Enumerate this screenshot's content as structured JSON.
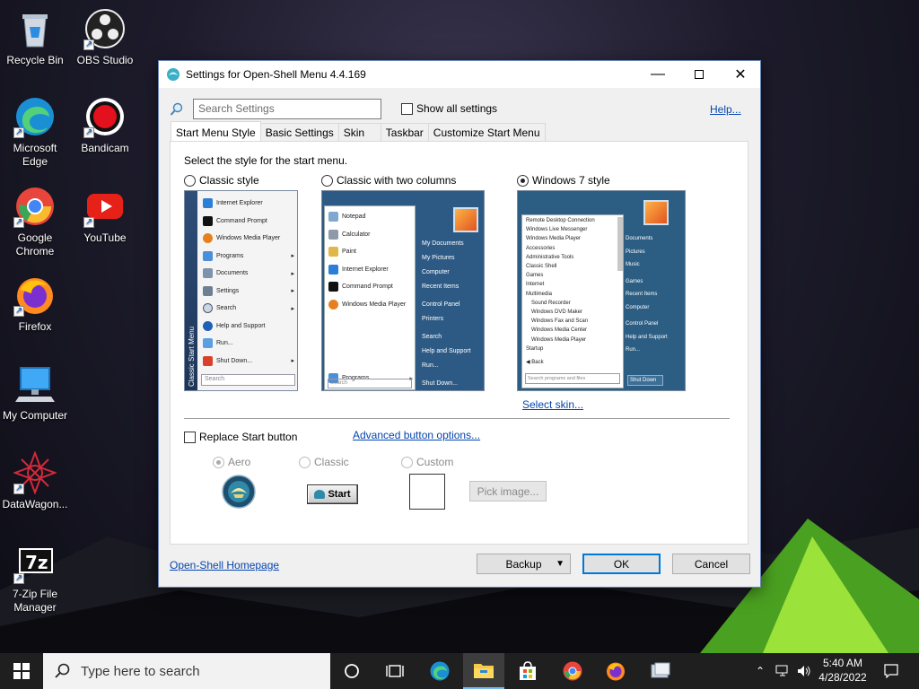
{
  "desktop": {
    "icons": [
      {
        "label": "Recycle Bin"
      },
      {
        "label": "OBS Studio"
      },
      {
        "label": "Microsoft Edge"
      },
      {
        "label": "Bandicam"
      },
      {
        "label": "Google Chrome"
      },
      {
        "label": "YouTube"
      },
      {
        "label": "Firefox"
      },
      {
        "label": "My Computer"
      },
      {
        "label": "DataWagon..."
      },
      {
        "label": "7-Zip File Manager"
      }
    ]
  },
  "window": {
    "title": "Settings for Open-Shell Menu 4.4.169",
    "search_placeholder": "Search Settings",
    "show_all_label": "Show all settings",
    "help_link": "Help...",
    "tabs": [
      {
        "label": "Start Menu Style"
      },
      {
        "label": "Basic Settings"
      },
      {
        "label": "Skin"
      },
      {
        "label": "Taskbar"
      },
      {
        "label": "Customize Start Menu"
      }
    ],
    "prompt": "Select the style for the start menu.",
    "styles": [
      {
        "label": "Classic style",
        "selected": false
      },
      {
        "label": "Classic with two columns",
        "selected": false
      },
      {
        "label": "Windows 7 style",
        "selected": true
      }
    ],
    "classic_preview": {
      "side_label": "Classic Start Menu",
      "items": [
        "Internet Explorer",
        "Command Prompt",
        "Windows Media Player",
        "Programs",
        "Documents",
        "Settings",
        "Search",
        "Help and Support",
        "Run...",
        "Shut Down..."
      ],
      "search": "Search"
    },
    "two_col_preview": {
      "left_items": [
        "Notepad",
        "Calculator",
        "Paint",
        "Internet Explorer",
        "Command Prompt",
        "Windows Media Player"
      ],
      "programs": "Programs",
      "search": "Search",
      "right_items": [
        "My Documents",
        "My Pictures",
        "Computer",
        "Recent Items",
        "Control Panel",
        "Printers",
        "Search",
        "Help and Support",
        "Run...",
        "Shut Down..."
      ]
    },
    "win7_preview": {
      "left_items": [
        "Remote Desktop Connection",
        "Windows Live Messenger",
        "Windows Media Player",
        "Accessories",
        "Administrative Tools",
        "Classic Shell",
        "Games",
        "Internet",
        "Multimedia",
        "Sound Recorder",
        "Windows DVD Maker",
        "Windows Fax and Scan",
        "Windows Media Center",
        "Windows Media Player",
        "Startup"
      ],
      "back": "Back",
      "search": "Search programs and files",
      "right_items": [
        "Documents",
        "Pictures",
        "Music",
        "Games",
        "Recent Items",
        "Computer",
        "Control Panel",
        "Help and Support",
        "Run..."
      ],
      "shutdown": "Shut Down"
    },
    "select_skin": "Select skin...",
    "replace_start_label": "Replace Start button",
    "advanced_button_link": "Advanced button options...",
    "button_styles": [
      {
        "label": "Aero",
        "selected": true
      },
      {
        "label": "Classic",
        "selected": false
      },
      {
        "label": "Custom",
        "selected": false
      }
    ],
    "classic_button_label": "Start",
    "pick_image": "Pick image...",
    "homepage_link": "Open-Shell Homepage",
    "backup_button": "Backup",
    "ok_button": "OK",
    "cancel_button": "Cancel"
  },
  "taskbar": {
    "search_placeholder": "Type here to search",
    "time": "5:40 AM",
    "date": "4/28/2022"
  },
  "colors": {
    "accent": "#0078d7",
    "link": "#0645ad",
    "menu_blue": "#2d5a85",
    "taskbar": "#1f1f1f"
  }
}
